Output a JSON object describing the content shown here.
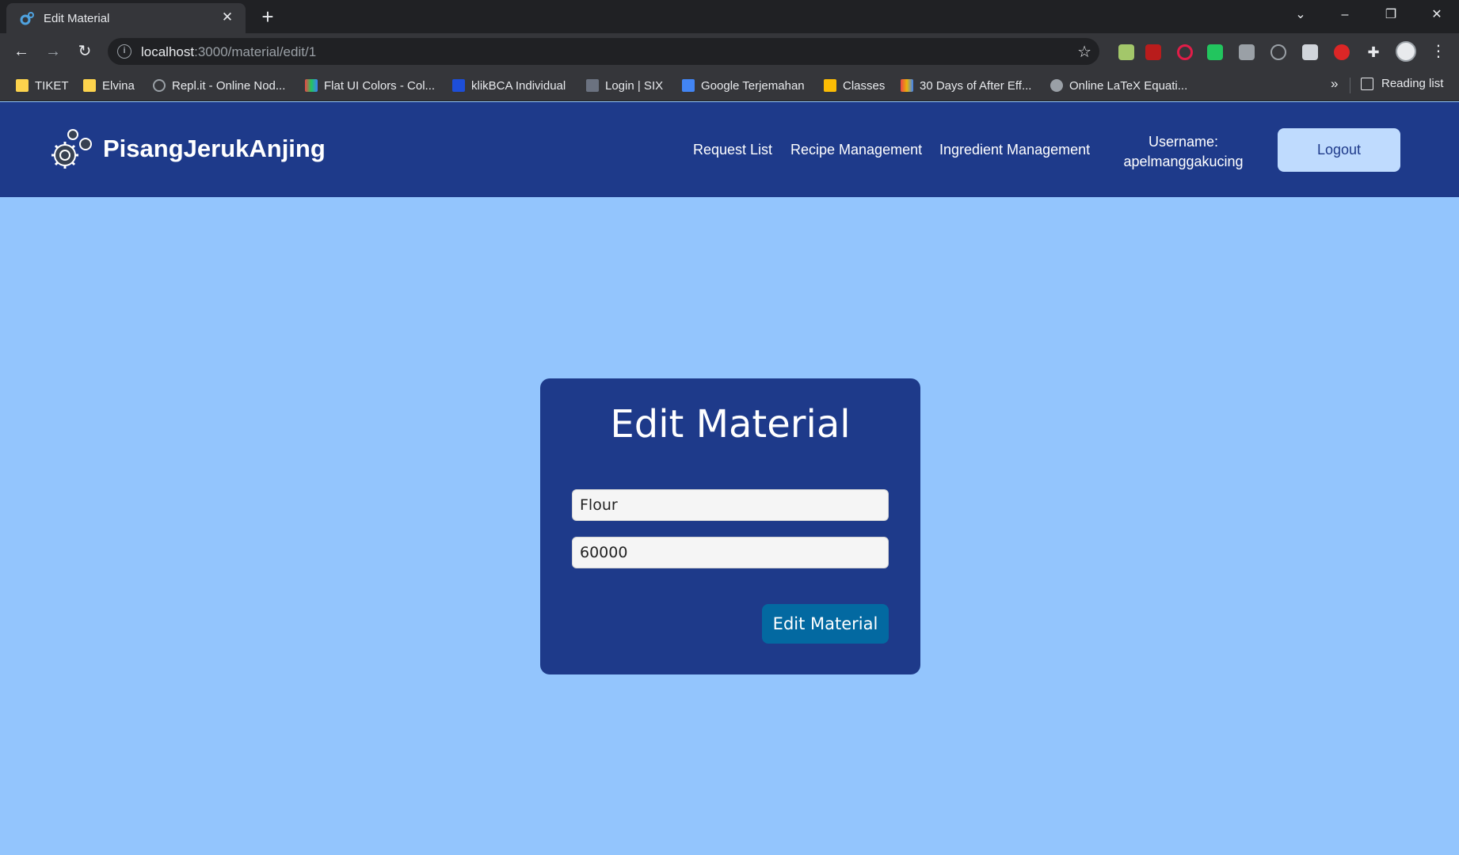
{
  "browser": {
    "tab_title": "Edit Material",
    "url_host": "localhost",
    "url_path": ":3000/material/edit/1",
    "bookmarks": [
      {
        "label": "TIKET",
        "icon": "folder-icon"
      },
      {
        "label": "Elvina",
        "icon": "folder-icon"
      },
      {
        "label": "Repl.it - Online Nod...",
        "icon": "replit-icon"
      },
      {
        "label": "Flat UI Colors - Col...",
        "icon": "flatui-icon"
      },
      {
        "label": "klikBCA Individual",
        "icon": "bca-icon"
      },
      {
        "label": "Login | SIX",
        "icon": "six-icon"
      },
      {
        "label": "Google Terjemahan",
        "icon": "translate-icon"
      },
      {
        "label": "Classes",
        "icon": "classroom-icon"
      },
      {
        "label": "30 Days of After Eff...",
        "icon": "aftereffects-icon"
      },
      {
        "label": "Online LaTeX Equati...",
        "icon": "gear-icon"
      }
    ],
    "reading_list": "Reading list"
  },
  "header": {
    "brand": "PisangJerukAnjing",
    "nav": [
      "Request List",
      "Recipe Management",
      "Ingredient Management"
    ],
    "username_label": "Username:",
    "username": "apelmanggakucing",
    "logout_label": "Logout"
  },
  "form": {
    "title": "Edit Material",
    "name_value": "Flour",
    "price_value": "60000",
    "submit_label": "Edit Material"
  },
  "colors": {
    "page_bg": "#93c5fd",
    "header_bg": "#1e3a8a",
    "card_bg": "#1e3a8a",
    "submit_bg": "#0369a1",
    "logout_bg": "#bfdbfe"
  }
}
